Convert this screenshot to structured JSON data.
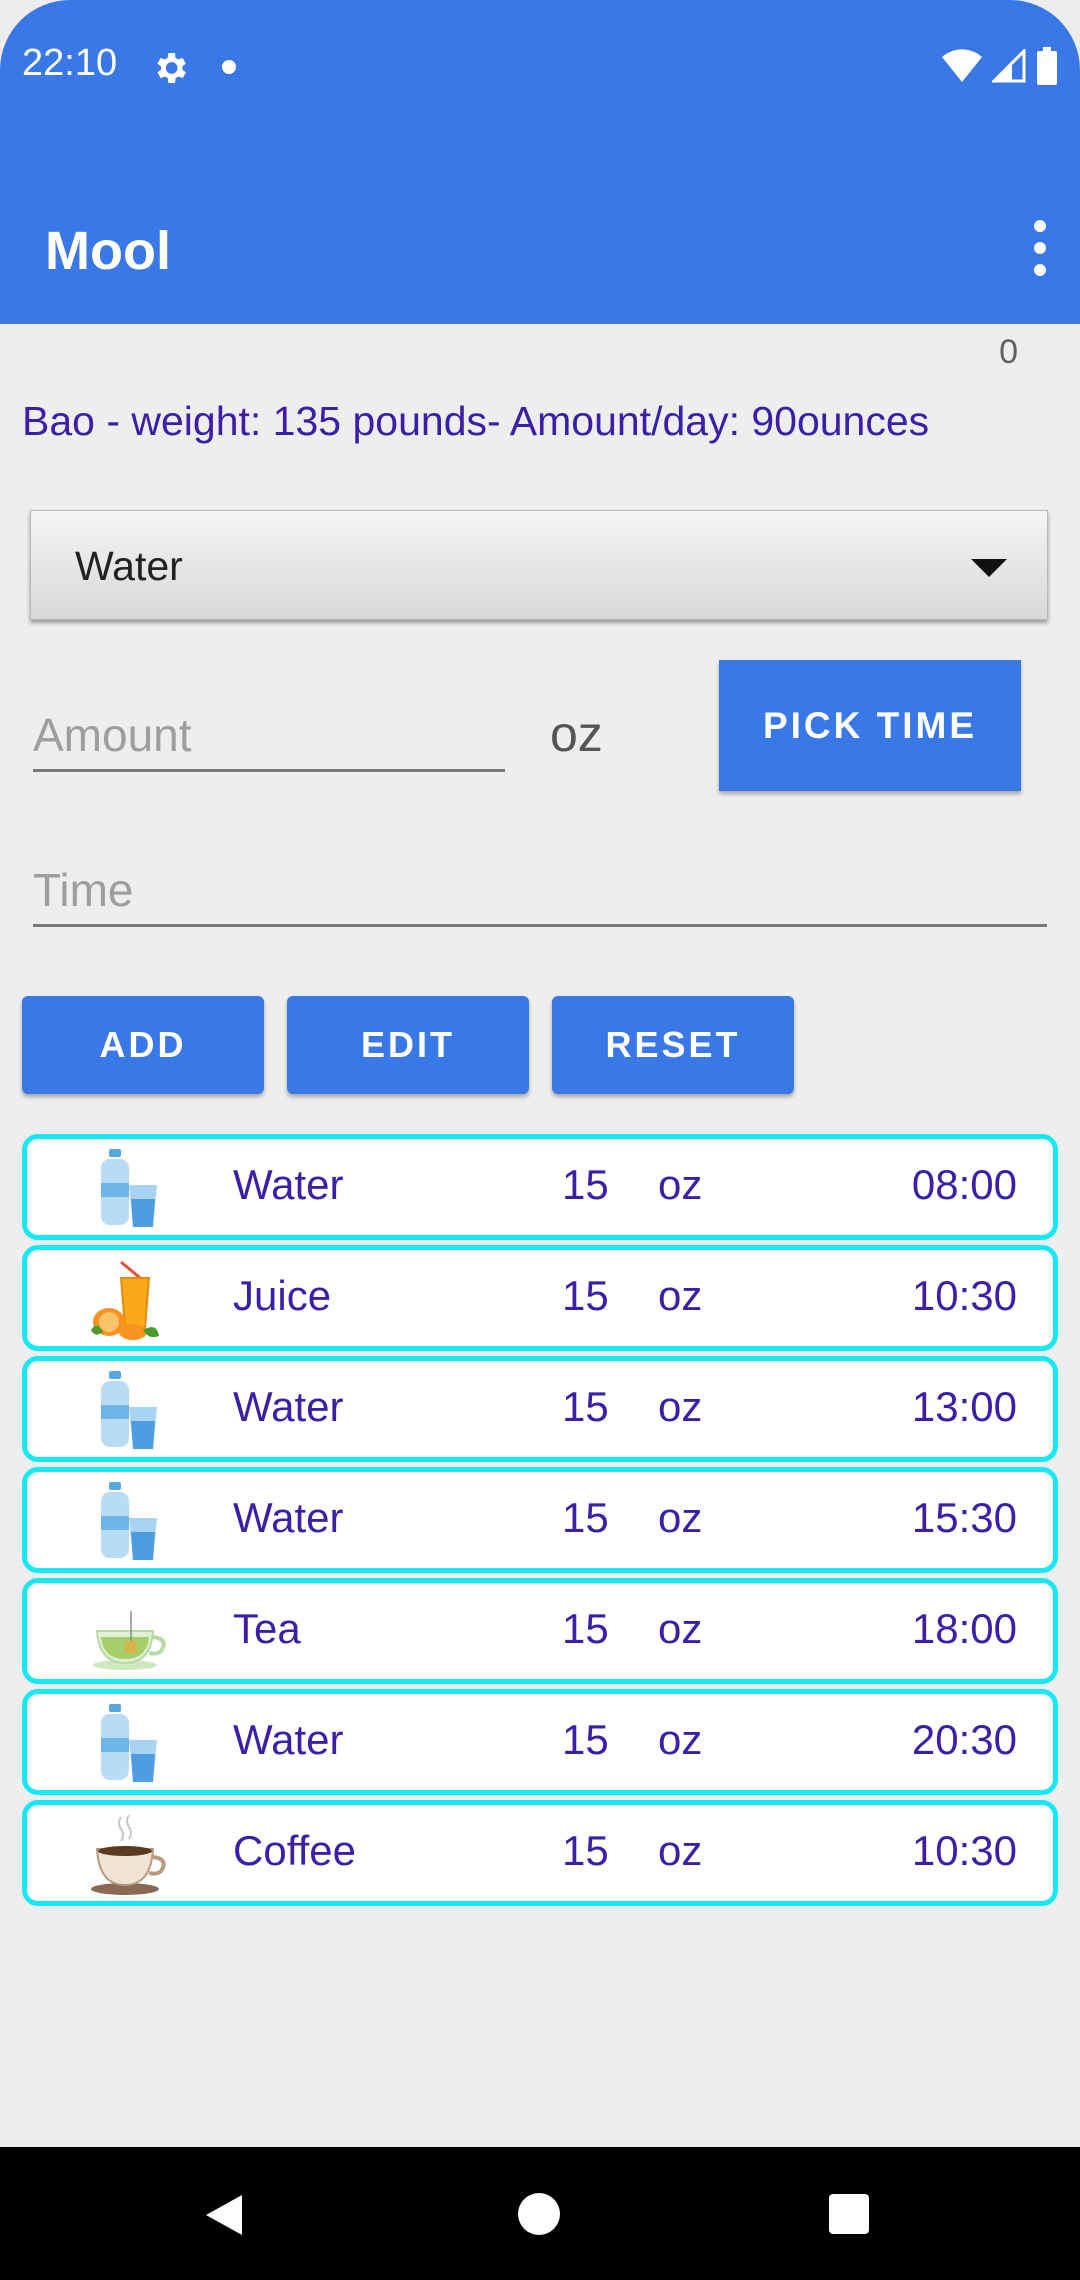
{
  "status_bar": {
    "time": "22:10",
    "icons": [
      "gear-icon",
      "notification-dot-icon",
      "wifi-icon",
      "signal-icon",
      "battery-icon"
    ]
  },
  "app_bar": {
    "title": "Mool",
    "menu_icon": "more-vertical-icon"
  },
  "counter": "0",
  "summary": "Bao - weight: 135 pounds- Amount/day: 90ounces",
  "drink_selector": {
    "selected": "Water"
  },
  "form": {
    "amount_placeholder": "Amount",
    "amount_unit": "oz",
    "pick_time_label": "PICK TIME",
    "time_placeholder": "Time"
  },
  "actions": {
    "add": "ADD",
    "edit": "EDIT",
    "reset": "RESET"
  },
  "entries": [
    {
      "drink": "Water",
      "amount": "15",
      "unit": "oz",
      "time": "08:00",
      "icon": "water-bottle-glass-icon"
    },
    {
      "drink": "Juice",
      "amount": "15",
      "unit": "oz",
      "time": "10:30",
      "icon": "orange-juice-icon"
    },
    {
      "drink": "Water",
      "amount": "15",
      "unit": "oz",
      "time": "13:00",
      "icon": "water-bottle-glass-icon"
    },
    {
      "drink": "Water",
      "amount": "15",
      "unit": "oz",
      "time": "15:30",
      "icon": "water-bottle-glass-icon"
    },
    {
      "drink": "Tea",
      "amount": "15",
      "unit": "oz",
      "time": "18:00",
      "icon": "tea-cup-icon"
    },
    {
      "drink": "Water",
      "amount": "15",
      "unit": "oz",
      "time": "20:30",
      "icon": "water-bottle-glass-icon"
    },
    {
      "drink": "Coffee",
      "amount": "15",
      "unit": "oz",
      "time": "10:30",
      "icon": "coffee-cup-icon"
    }
  ],
  "colors": {
    "primary": "#3a78e7",
    "list_border": "#16e8f5",
    "text_accent": "#3b1fa8",
    "background": "#eeeeee"
  },
  "nav_bar": {
    "icons": [
      "back-icon",
      "home-icon",
      "recents-icon"
    ]
  }
}
